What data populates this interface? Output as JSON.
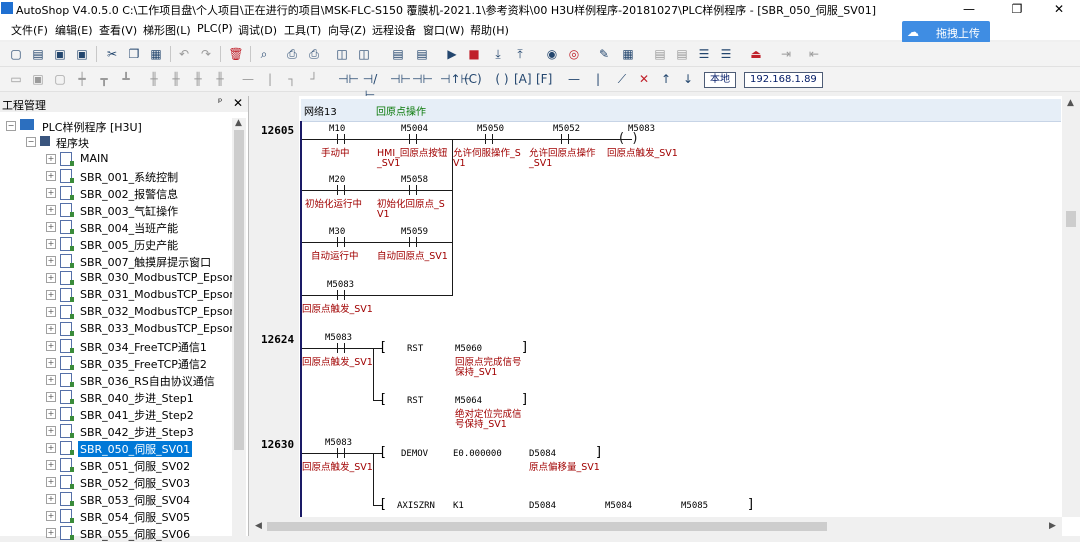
{
  "window": {
    "title": "AutoShop V4.0.5.0  C:\\工作项目盘\\个人项目\\正在进行的项目\\MSK-FLC-S150 覆膜机-2021.1\\参考资料\\00 H3U样例程序-20181027\\PLC样例程序 - [SBR_050_伺服_SV01]",
    "minimize": "—",
    "restore": "❐",
    "close": "✕"
  },
  "menu": [
    "文件(F)",
    "编辑(E)",
    "查看(V)",
    "梯形图(L)",
    "PLC(P)",
    "调试(D)",
    "工具(T)",
    "向导(Z)",
    "远程设备",
    "窗口(W)",
    "帮助(H)"
  ],
  "cloud": {
    "label": "拖拽上传",
    "icon": "cloud-icon"
  },
  "toolbar2": {
    "local": "本地",
    "ip": "192.168.1.89"
  },
  "project_panel": {
    "title": "工程管理",
    "pin": "ᵖ",
    "close": "✕",
    "root": "PLC样例程序 [H3U]",
    "folder": "程序块",
    "items": [
      "MAIN",
      "SBR_001_系统控制",
      "SBR_002_报警信息",
      "SBR_003_气缸操作",
      "SBR_004_当班产能",
      "SBR_005_历史产能",
      "SBR_007_触摸屏提示窗口",
      "SBR_030_ModbusTCP_Epson1",
      "SBR_031_ModbusTCP_Epson2",
      "SBR_032_ModbusTCP_Epson3",
      "SBR_033_ModbusTCP_Epson4",
      "SBR_034_FreeTCP通信1",
      "SBR_035_FreeTCP通信2",
      "SBR_036_RS自由协议通信",
      "SBR_040_步进_Step1",
      "SBR_041_步进_Step2",
      "SBR_042_步进_Step3",
      "SBR_050_伺服_SV01",
      "SBR_051_伺服_SV02",
      "SBR_052_伺服_SV03",
      "SBR_053_伺服_SV04",
      "SBR_054_伺服_SV05",
      "SBR_055_伺服_SV06"
    ],
    "selected_index": 17
  },
  "ladder": {
    "network_label": "网络13",
    "network_comment": "回原点操作",
    "rungs": [
      "12605",
      "12624",
      "12630"
    ],
    "r1": {
      "c1_addr": "M10",
      "c1_cmt": "手动中",
      "c2_addr": "M5004",
      "c2_cmt1": "HMI_回原点按钮",
      "c2_cmt2": "_SV1",
      "c3_addr": "M5050",
      "c3_cmt1": "允许伺服操作_S",
      "c3_cmt2": "V1",
      "c4_addr": "M5052",
      "c4_cmt1": "允许回原点操作",
      "c4_cmt2": "_SV1",
      "coil_addr": "M5083",
      "coil_cmt": "回原点触发_SV1",
      "b1_addr": "M20",
      "b1_cmt": "初始化运行中",
      "b2_addr": "M5058",
      "b2_cmt1": "初始化回原点_S",
      "b2_cmt2": "V1",
      "b3_addr": "M30",
      "b3_cmt": "自动运行中",
      "b4_addr": "M5059",
      "b4_cmt": "自动回原点_SV1",
      "b5_addr": "M5083",
      "b5_cmt": "回原点触发_SV1"
    },
    "r2": {
      "c_addr": "M5083",
      "c_cmt": "回原点触发_SV1",
      "i1_op": "RST",
      "i1_arg": "M5060",
      "i1_cmt1": "回原点完成信号",
      "i1_cmt2": "保持_SV1",
      "i2_op": "RST",
      "i2_arg": "M5064",
      "i2_cmt1": "绝对定位完成信",
      "i2_cmt2": "号保持_SV1"
    },
    "r3": {
      "c_addr": "M5083",
      "c_cmt": "回原点触发_SV1",
      "i1_op": "DEMOV",
      "i1_a1": "E0.000000",
      "i1_a2": "D5084",
      "i1_cmt": "原点偏移量_SV1",
      "i2_op": "AXISZRN",
      "i2_a1": "K1",
      "i2_a2": "D5084",
      "i2_a3": "M5084",
      "i2_a4": "M5085"
    }
  }
}
